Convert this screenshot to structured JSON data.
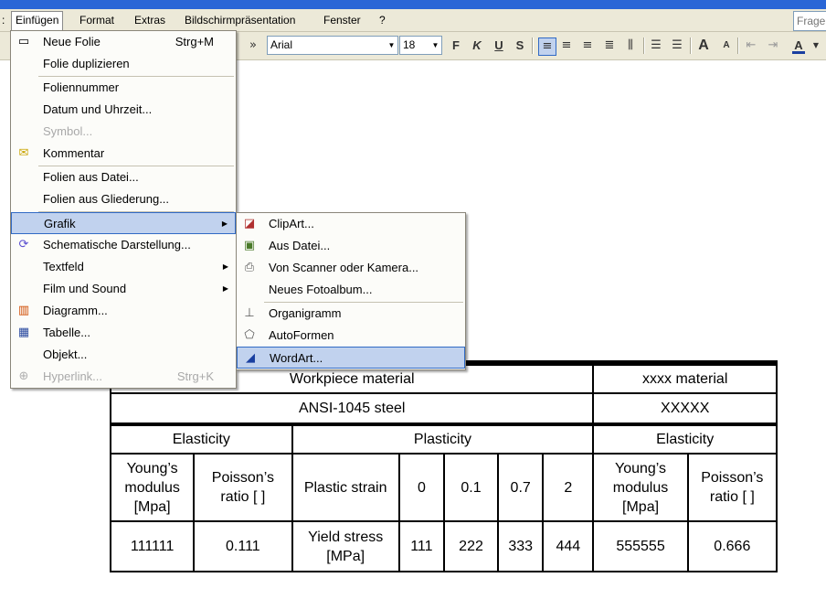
{
  "menubar": {
    "items": [
      ":",
      "Einfügen",
      "Format",
      "Extras",
      "Bildschirmpräsentation",
      "Fenster",
      "?"
    ],
    "ask_placeholder": "Frage"
  },
  "toolbar": {
    "font": "Arial",
    "size": "18",
    "bold": "F",
    "italic": "K",
    "underline": "U",
    "shadow": "S",
    "grow_font": "A",
    "shrink_font": "A",
    "font_color": "A",
    "more": "»"
  },
  "insert_menu": {
    "items": [
      {
        "label": "Neue Folie",
        "shortcut": "Strg+M",
        "icon": "new-slide-icon"
      },
      {
        "label": "Folie duplizieren"
      },
      {
        "label": "Foliennummer"
      },
      {
        "label": "Datum und Uhrzeit..."
      },
      {
        "label": "Symbol...",
        "disabled": true
      },
      {
        "label": "Kommentar",
        "icon": "comment-icon"
      },
      {
        "label": "Folien aus Datei..."
      },
      {
        "label": "Folien aus Gliederung..."
      },
      {
        "label": "Grafik",
        "submenu": true
      },
      {
        "label": "Schematische Darstellung...",
        "icon": "diagram-cycle-icon"
      },
      {
        "label": "Textfeld",
        "submenu": true
      },
      {
        "label": "Film und Sound",
        "submenu": true
      },
      {
        "label": "Diagramm...",
        "icon": "chart-icon"
      },
      {
        "label": "Tabelle...",
        "icon": "table-icon"
      },
      {
        "label": "Objekt..."
      },
      {
        "label": "Hyperlink...",
        "shortcut": "Strg+K",
        "disabled": true,
        "icon": "hyperlink-icon"
      }
    ]
  },
  "graphic_submenu": {
    "items": [
      {
        "label": "ClipArt...",
        "icon": "clipart-icon"
      },
      {
        "label": "Aus Datei...",
        "icon": "picture-icon"
      },
      {
        "label": "Von Scanner oder Kamera...",
        "icon": "scanner-icon"
      },
      {
        "label": "Neues Fotoalbum..."
      },
      {
        "label": "Organigramm",
        "icon": "org-chart-icon"
      },
      {
        "label": "AutoFormen",
        "icon": "autoshapes-icon"
      },
      {
        "label": "WordArt...",
        "icon": "wordart-icon"
      }
    ]
  },
  "slide_table": {
    "workpiece_material": "Workpiece material",
    "xxxx_material": "xxxx material",
    "steel": "ANSI-1045 steel",
    "xxxxx": "XXXXX",
    "elasticity_1": "Elasticity",
    "plasticity": "Plasticity",
    "elasticity_2": "Elasticity",
    "youngs_1": "Young’s modulus [Mpa]",
    "poisson_1": "Poisson’s ratio [ ]",
    "plastic_strain": "Plastic strain",
    "strains": [
      "0",
      "0.1",
      "0.7",
      "2"
    ],
    "youngs_2": "Young’s modulus [Mpa]",
    "poisson_2": "Poisson’s ratio [ ]",
    "youngs_val_1": "111111",
    "poisson_val_1": "0.111",
    "yield_stress": "Yield stress [MPa]",
    "stresses": [
      "111",
      "222",
      "333",
      "444"
    ],
    "youngs_val_2": "555555",
    "poisson_val_2": "0.666"
  }
}
